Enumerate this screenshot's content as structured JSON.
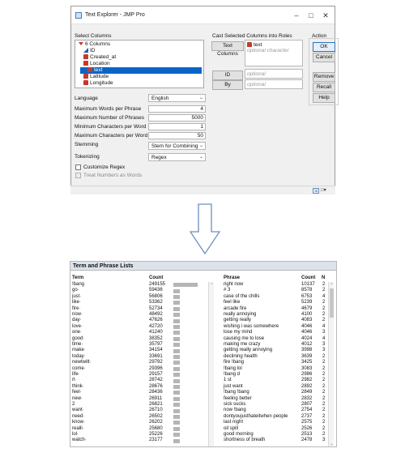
{
  "dialog": {
    "title": "Text Explorer - JMP Pro",
    "select_columns_label": "Select Columns",
    "columns_count": "6 Columns",
    "columns": [
      {
        "name": "ID",
        "type": "continuous"
      },
      {
        "name": "Created_at",
        "type": "nominal"
      },
      {
        "name": "Location",
        "type": "nominal"
      },
      {
        "name": "text",
        "type": "nominal",
        "selected": true
      },
      {
        "name": "Latitude",
        "type": "nominal"
      },
      {
        "name": "Longitude",
        "type": "nominal"
      }
    ],
    "cast_label": "Cast Selected Columns into Roles",
    "text_columns_button": "Text Columns",
    "text_columns_value": "text",
    "text_columns_hint": "optional character",
    "id_button": "ID",
    "id_hint": "optional",
    "by_button": "By",
    "by_hint": "optional",
    "action_label": "Action",
    "ok": "OK",
    "cancel": "Cancel",
    "remove": "Remove",
    "recall": "Recall",
    "help": "Help",
    "language_label": "Language",
    "language_value": "English",
    "max_words_label": "Maximum Words per Phrase",
    "max_words_value": "4",
    "max_phrases_label": "Maximum Number of Phrases",
    "max_phrases_value": "5000",
    "min_chars_label": "Minimum Characters per Word",
    "min_chars_value": "1",
    "max_chars_label": "Maximum Characters per Word",
    "max_chars_value": "50",
    "stemming_label": "Stemming",
    "stemming_value": "Stem for Combining",
    "tokenizing_label": "Tokenizing",
    "tokenizing_value": "Regex",
    "customize_regex": "Customize Regex",
    "treat_numbers": "Treat Numbers as Words"
  },
  "report": {
    "title": "Term and Phrase Lists",
    "term_header": "Term",
    "count_header": "Count",
    "phrase_header": "Phrase",
    "phrase_count_header": "Count",
    "n_header": "N",
    "terms": [
      {
        "term": "!bang",
        "count": 249155
      },
      {
        "term": "go·",
        "count": 59436
      },
      {
        "term": "just·",
        "count": 56806
      },
      {
        "term": "like·",
        "count": 53362
      },
      {
        "term": "fire·",
        "count": 52734
      },
      {
        "term": "now·",
        "count": 48492
      },
      {
        "term": "day·",
        "count": 47626
      },
      {
        "term": "love·",
        "count": 42720
      },
      {
        "term": "one·",
        "count": 41240
      },
      {
        "term": "good·",
        "count": 38352
      },
      {
        "term": "time·",
        "count": 35797
      },
      {
        "term": "make·",
        "count": 34154
      },
      {
        "term": "today·",
        "count": 33691
      },
      {
        "term": "newtwitt·",
        "count": 29792
      },
      {
        "term": "come·",
        "count": 29396
      },
      {
        "term": "life·",
        "count": 29157
      },
      {
        "term": "rt·",
        "count": 28742
      },
      {
        "term": "think·",
        "count": 28676
      },
      {
        "term": "feel·",
        "count": 28436
      },
      {
        "term": "new·",
        "count": 26911
      },
      {
        "term": "2",
        "count": 26821
      },
      {
        "term": "want·",
        "count": 26710
      },
      {
        "term": "need·",
        "count": 26502
      },
      {
        "term": "know·",
        "count": 26202
      },
      {
        "term": "realli·",
        "count": 25680
      },
      {
        "term": "lol·",
        "count": 25226
      },
      {
        "term": "watch·",
        "count": 23177
      }
    ],
    "phrases": [
      {
        "phrase": "right now",
        "count": 10137,
        "n": 2
      },
      {
        "phrase": "# 3",
        "count": 8578,
        "n": 2
      },
      {
        "phrase": "case of the chills",
        "count": 6753,
        "n": 4
      },
      {
        "phrase": "feel like",
        "count": 5239,
        "n": 2
      },
      {
        "phrase": "arcade fire",
        "count": 4679,
        "n": 2
      },
      {
        "phrase": "really annoying",
        "count": 4100,
        "n": 2
      },
      {
        "phrase": "getting really",
        "count": 4083,
        "n": 2
      },
      {
        "phrase": "wishing i was somewhere",
        "count": 4046,
        "n": 4
      },
      {
        "phrase": "lose my mind",
        "count": 4046,
        "n": 3
      },
      {
        "phrase": "causing me to lose",
        "count": 4024,
        "n": 4
      },
      {
        "phrase": "making me crazy",
        "count": 4012,
        "n": 3
      },
      {
        "phrase": "getting really annoying",
        "count": 3998,
        "n": 3
      },
      {
        "phrase": "declining health",
        "count": 3639,
        "n": 2
      },
      {
        "phrase": "fire !bang",
        "count": 3425,
        "n": 2
      },
      {
        "phrase": "!bang lol",
        "count": 3083,
        "n": 2
      },
      {
        "phrase": "!bang d",
        "count": 2986,
        "n": 2
      },
      {
        "phrase": "1 st",
        "count": 2982,
        "n": 2
      },
      {
        "phrase": "just want",
        "count": 2892,
        "n": 2
      },
      {
        "phrase": "!bang !bang",
        "count": 2849,
        "n": 2
      },
      {
        "phrase": "feeling better",
        "count": 2832,
        "n": 2
      },
      {
        "phrase": "sick sucks",
        "count": 2807,
        "n": 2
      },
      {
        "phrase": "now !bang",
        "count": 2754,
        "n": 2
      },
      {
        "phrase": "dontyoujusthateitwhen people",
        "count": 2737,
        "n": 2
      },
      {
        "phrase": "last night",
        "count": 2575,
        "n": 2
      },
      {
        "phrase": "oil spill",
        "count": 2526,
        "n": 2
      },
      {
        "phrase": "good morning",
        "count": 2513,
        "n": 2
      },
      {
        "phrase": "shortness of breath",
        "count": 2478,
        "n": 3
      }
    ]
  }
}
